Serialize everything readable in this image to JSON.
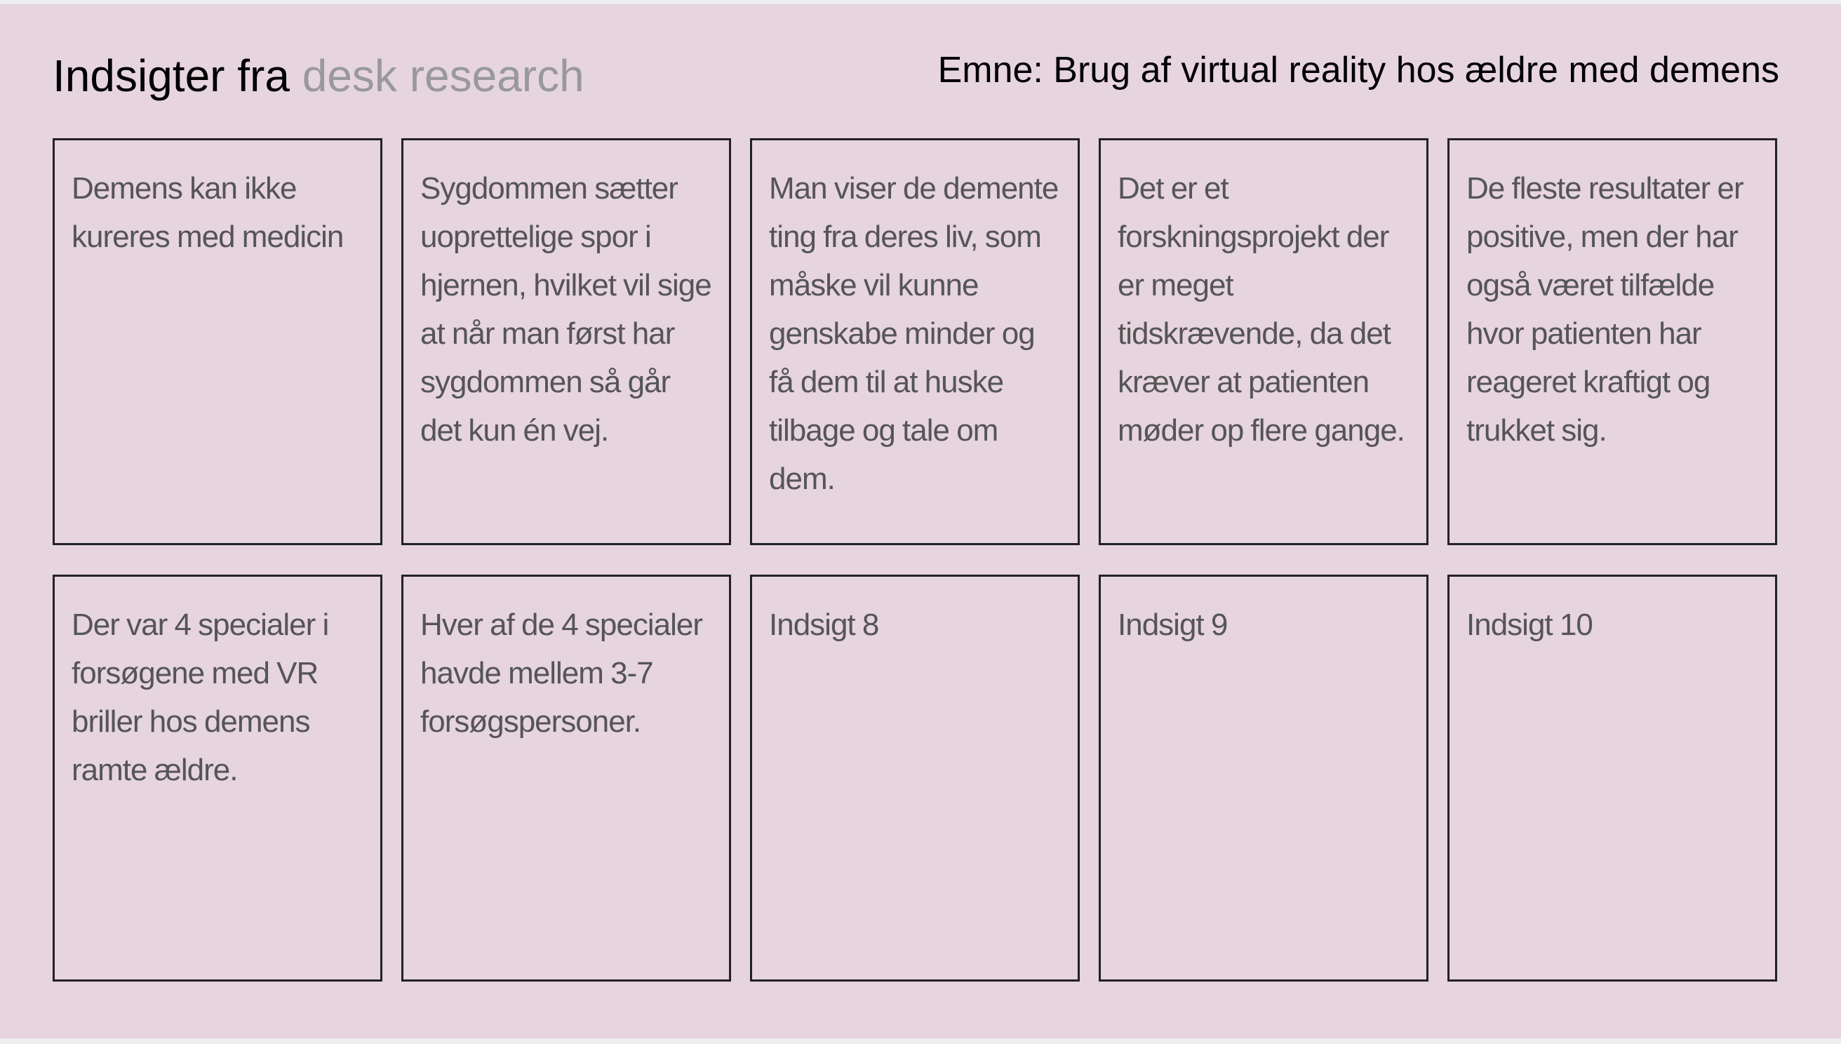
{
  "header": {
    "title_main": "Indsigter fra",
    "title_muted": "desk research",
    "topic": "Emne: Brug af virtual reality hos ældre med demens"
  },
  "insights": [
    {
      "text": "Demens kan ikke kureres med medicin"
    },
    {
      "text": "Sygdommen sætter uoprettelige spor i hjernen, hvilket vil sige at når man først har sygdommen så går det kun én vej."
    },
    {
      "text": "Man viser de demente ting fra deres liv, som måske vil kunne genskabe minder og få dem til at huske tilbage og tale om dem."
    },
    {
      "text": "Det er et forskningsprojekt der er meget tidskrævende, da det kræver at patienten møder op flere gange."
    },
    {
      "text": "De fleste resultater er positive, men der har også været tilfælde hvor patienten har reageret kraftigt og trukket sig."
    },
    {
      "text": "Der var 4 specialer i forsøgene med VR briller hos demens ramte ældre."
    },
    {
      "text": "Hver af de 4 specialer havde mellem 3-7 forsøgspersoner."
    },
    {
      "text": "Indsigt 8"
    },
    {
      "text": "Indsigt 9"
    },
    {
      "text": "Indsigt 10"
    }
  ]
}
